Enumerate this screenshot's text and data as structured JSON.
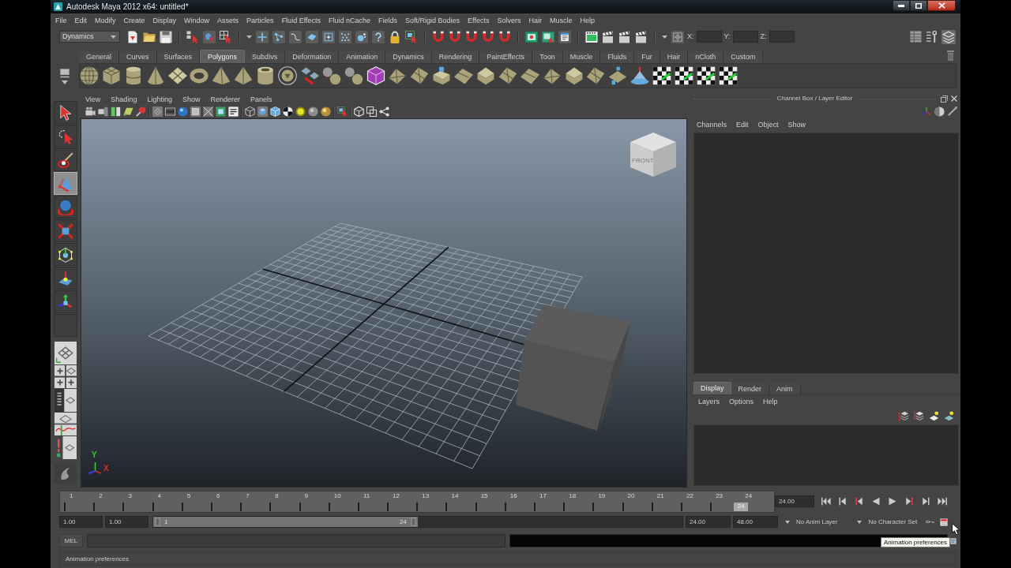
{
  "window": {
    "title": "Autodesk Maya 2012 x64: untitled*"
  },
  "menu_bar": [
    "File",
    "Edit",
    "Modify",
    "Create",
    "Display",
    "Window",
    "Assets",
    "Particles",
    "Fluid Effects",
    "Fluid nCache",
    "Fields",
    "Soft/Rigid Bodies",
    "Effects",
    "Solvers",
    "Hair",
    "Muscle",
    "Help"
  ],
  "status_line": {
    "menu_set": "Dynamics",
    "coordinate_fields": [
      {
        "label": "X:"
      },
      {
        "label": "Y:"
      },
      {
        "label": "Z:"
      }
    ]
  },
  "shelf": {
    "tabs": [
      {
        "label": "General",
        "selected": false
      },
      {
        "label": "Curves",
        "selected": false
      },
      {
        "label": "Surfaces",
        "selected": false
      },
      {
        "label": "Polygons",
        "selected": true
      },
      {
        "label": "Subdivs",
        "selected": false
      },
      {
        "label": "Deformation",
        "selected": false
      },
      {
        "label": "Animation",
        "selected": false
      },
      {
        "label": "Dynamics",
        "selected": false
      },
      {
        "label": "Rendering",
        "selected": false
      },
      {
        "label": "PaintEffects",
        "selected": false
      },
      {
        "label": "Toon",
        "selected": false
      },
      {
        "label": "Muscle",
        "selected": false
      },
      {
        "label": "Fluids",
        "selected": false
      },
      {
        "label": "Fur",
        "selected": false
      },
      {
        "label": "Hair",
        "selected": false
      },
      {
        "label": "nCloth",
        "selected": false
      },
      {
        "label": "Custom",
        "selected": false
      }
    ]
  },
  "toolbox": {
    "tools": [
      {
        "kind": "select",
        "selected": false
      },
      {
        "kind": "lasso",
        "selected": false
      },
      {
        "kind": "paint",
        "selected": false
      },
      {
        "kind": "move",
        "selected": true
      },
      {
        "kind": "rotate",
        "selected": false
      },
      {
        "kind": "scale",
        "selected": false
      },
      {
        "kind": "universal",
        "selected": false
      },
      {
        "kind": "softmod",
        "selected": false
      },
      {
        "kind": "showmanip",
        "selected": false
      },
      {
        "kind": "empty",
        "selected": false
      }
    ]
  },
  "viewport": {
    "menus": [
      "View",
      "Shading",
      "Lighting",
      "Show",
      "Renderer",
      "Panels"
    ],
    "toolbar_groups": [
      [
        {
          "kind": "camera",
          "on": false
        },
        {
          "kind": "camattr",
          "on": false
        },
        {
          "kind": "bookmark",
          "on": false
        },
        {
          "kind": "imageplane",
          "on": false
        },
        {
          "kind": "pan",
          "on": false
        }
      ],
      [
        {
          "kind": "grid",
          "on": true
        },
        {
          "kind": "film",
          "on": false
        },
        {
          "kind": "sphereblue",
          "on": false
        },
        {
          "kind": "square",
          "on": true
        },
        {
          "kind": "xray",
          "on": false
        },
        {
          "kind": "isolate",
          "on": false
        },
        {
          "kind": "hud",
          "on": false
        }
      ],
      [
        {
          "kind": "wirecube",
          "on": false
        },
        {
          "kind": "shadedcube",
          "on": true
        },
        {
          "kind": "wireshaded",
          "on": false
        },
        {
          "kind": "checkerball",
          "on": false
        },
        {
          "kind": "light",
          "on": false
        },
        {
          "kind": "greyball",
          "on": false
        },
        {
          "kind": "goldball",
          "on": false
        }
      ],
      [
        {
          "kind": "selbox",
          "on": false
        }
      ],
      [
        {
          "kind": "cubeoutline",
          "on": false
        },
        {
          "kind": "twosquares",
          "on": false
        },
        {
          "kind": "share",
          "on": false
        }
      ]
    ],
    "view_cube": {
      "label": "FRONT"
    },
    "axis_labels": [
      {
        "label": "Y",
        "color": "#38c838"
      },
      {
        "label": "X",
        "color": "#e02828"
      }
    ]
  },
  "channel_box": {
    "title": "Channel Box / Layer Editor",
    "menus": [
      "Channels",
      "Edit",
      "Object",
      "Show"
    ]
  },
  "layer_editor": {
    "tabs": [
      {
        "label": "Display",
        "selected": true
      },
      {
        "label": "Render",
        "selected": false
      },
      {
        "label": "Anim",
        "selected": false
      }
    ],
    "menus": [
      "Layers",
      "Options",
      "Help"
    ]
  },
  "time_slider": {
    "frames": [
      {
        "label": "1",
        "selected": false
      },
      {
        "label": "2",
        "selected": false
      },
      {
        "label": "3",
        "selected": false
      },
      {
        "label": "4",
        "selected": false
      },
      {
        "label": "5",
        "selected": false
      },
      {
        "label": "6",
        "selected": false
      },
      {
        "label": "7",
        "selected": false
      },
      {
        "label": "8",
        "selected": false
      },
      {
        "label": "9",
        "selected": false
      },
      {
        "label": "10",
        "selected": false
      },
      {
        "label": "11",
        "selected": false
      },
      {
        "label": "12",
        "selected": false
      },
      {
        "label": "13",
        "selected": false
      },
      {
        "label": "14",
        "selected": false
      },
      {
        "label": "15",
        "selected": false
      },
      {
        "label": "16",
        "selected": false
      },
      {
        "label": "17",
        "selected": false
      },
      {
        "label": "18",
        "selected": false
      },
      {
        "label": "19",
        "selected": false
      },
      {
        "label": "20",
        "selected": false
      },
      {
        "label": "21",
        "selected": false
      },
      {
        "label": "22",
        "selected": false
      },
      {
        "label": "23",
        "selected": false
      },
      {
        "label": "24",
        "selected": true
      }
    ],
    "current_frame": "24",
    "current_time": "24.00"
  },
  "range_slider": {
    "start_time": "1.00",
    "playback_start": "1.00",
    "range": {
      "start": "1",
      "end": "24",
      "level": 0.5
    },
    "playback_end": "24.00",
    "end_time": "48.00",
    "anim_layer": "No Anim Layer",
    "character_set": "No Character Set"
  },
  "command_line": {
    "language": "MEL"
  },
  "tooltip": {
    "text": "Animation preferences"
  },
  "help_line": {
    "text": "Animation preferences"
  }
}
